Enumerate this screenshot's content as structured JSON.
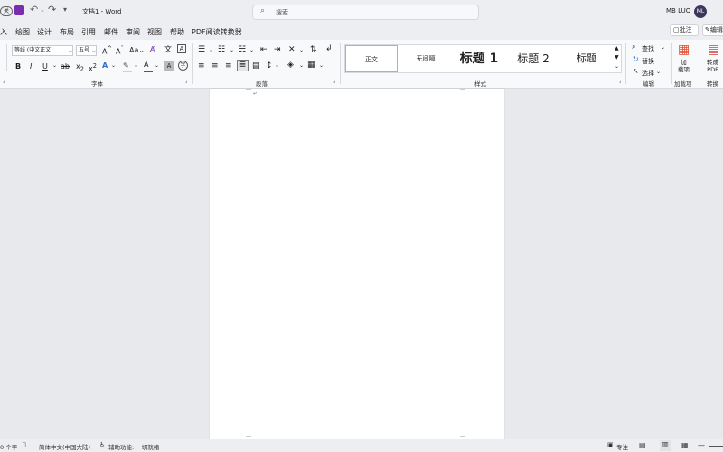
{
  "titlebar": {
    "autosave_state": "关",
    "document_title": "文档1 - Word",
    "search_placeholder": "搜索",
    "user_name": "MB LUO",
    "avatar_initials": "ML"
  },
  "menu": {
    "items": [
      "入",
      "绘图",
      "设计",
      "布局",
      "引用",
      "邮件",
      "审阅",
      "视图",
      "帮助",
      "PDF阅读转换器"
    ],
    "comment_button": "批注",
    "edit_button": "编辑"
  },
  "ribbon": {
    "font": {
      "font_name": "等线 (中文正文)",
      "font_size": "五号",
      "group_label": "字体",
      "icons": [
        "increase-font-icon",
        "decrease-font-icon",
        "change-case-icon",
        "clear-format-icon",
        "phonetic-guide-icon",
        "character-border-icon",
        "bold-icon",
        "italic-icon",
        "underline-icon",
        "strikethrough-icon",
        "subscript-icon",
        "superscript-icon",
        "text-effects-icon",
        "highlight-icon",
        "font-color-icon",
        "character-shading-icon",
        "enclosed-character-icon"
      ]
    },
    "paragraph": {
      "group_label": "段落",
      "icons": [
        "bullets-icon",
        "numbering-icon",
        "multilevel-list-icon",
        "decrease-indent-icon",
        "increase-indent-icon",
        "chinese-layout-icon",
        "sort-icon",
        "show-marks-icon",
        "align-left-icon",
        "align-center-icon",
        "align-right-icon",
        "justify-icon",
        "distributed-icon",
        "line-spacing-icon",
        "shading-icon",
        "borders-icon"
      ]
    },
    "styles": {
      "group_label": "样式",
      "items": [
        "正文",
        "无间隔",
        "标题 1",
        "标题 2",
        "标题"
      ]
    },
    "editing": {
      "group_label": "编辑",
      "find": "查找",
      "replace": "替换",
      "select": "选择"
    },
    "addins": {
      "group_label": "加载项",
      "button": "加\n载项"
    },
    "convert": {
      "group_label": "转换",
      "button": "转成\nPDF"
    }
  },
  "statusbar": {
    "word_count": "0 个字",
    "language": "简体中文(中国大陆)",
    "accessibility": "辅助功能: 一切就绪",
    "focus": "专注"
  },
  "colors": {
    "accent_red": "#c42b1c",
    "highlight_yellow": "#ffe100",
    "brand_purple": "#7e4bb9"
  }
}
